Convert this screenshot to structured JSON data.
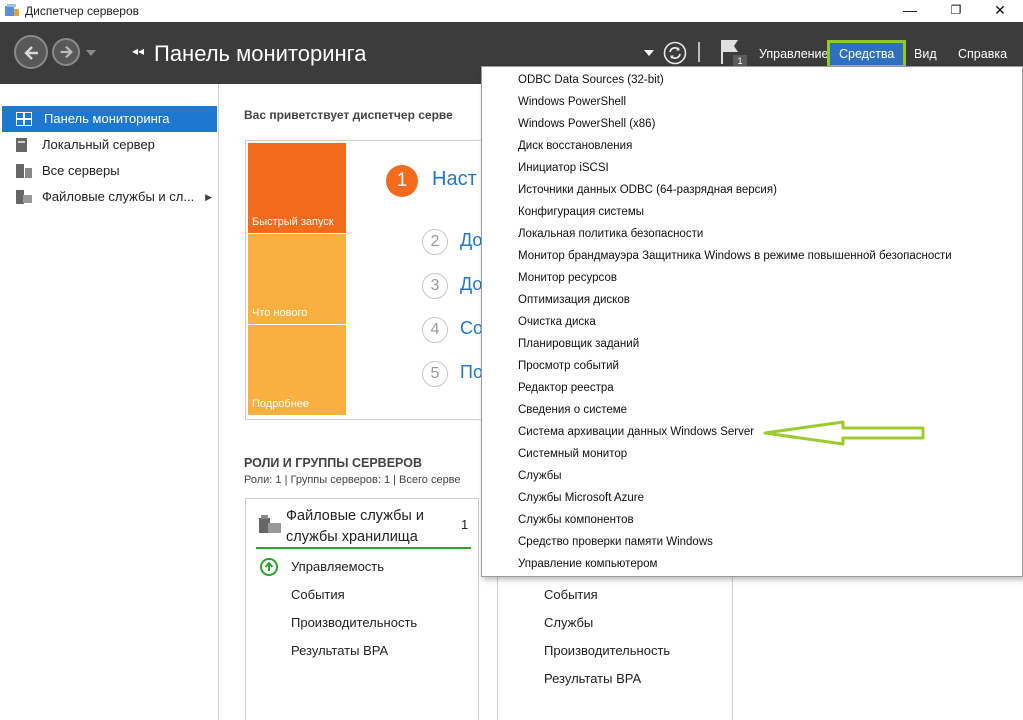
{
  "window": {
    "title": "Диспетчер серверов",
    "controls": {
      "minimize": "—",
      "restore": "❐",
      "close": "✕"
    }
  },
  "header": {
    "breadcrumb_arrows": "◂◂",
    "page_title": "Панель мониторинга",
    "flag_count": "1",
    "menu": {
      "manage": "Управление",
      "tools": "Средства",
      "view": "Вид",
      "help": "Справка"
    }
  },
  "sidebar": {
    "items": [
      {
        "label": "Панель мониторинга",
        "icon": "dashboard-icon"
      },
      {
        "label": "Локальный сервер",
        "icon": "server-icon"
      },
      {
        "label": "Все серверы",
        "icon": "servers-icon"
      },
      {
        "label": "Файловые службы и сл...",
        "icon": "file-services-icon"
      }
    ]
  },
  "main": {
    "welcome": "Вас приветствует диспетчер серве",
    "tiles": {
      "quick_start": "Быстрый запуск",
      "whats_new": "Что нового",
      "learn_more": "Подробнее"
    },
    "steps": [
      {
        "num": "1",
        "label": "Наст"
      },
      {
        "num": "2",
        "label": "До"
      },
      {
        "num": "3",
        "label": "До"
      },
      {
        "num": "4",
        "label": "Со"
      },
      {
        "num": "5",
        "label": "По"
      }
    ],
    "roles_title": "РОЛИ И ГРУППЫ СЕРВЕРОВ",
    "roles_sub": "Роли: 1 | Группы серверов: 1 | Всего серве",
    "card1": {
      "title": "Файловые службы и службы хранилища",
      "count": "1",
      "rows": [
        "Управляемость",
        "События",
        "Производительность",
        "Результаты BPA"
      ]
    },
    "card2": {
      "rows": [
        "События",
        "Службы",
        "Производительность",
        "Результаты BPA"
      ]
    }
  },
  "tools_menu": {
    "items": [
      "ODBC Data Sources (32-bit)",
      "Windows PowerShell",
      "Windows PowerShell (x86)",
      "Диск восстановления",
      "Инициатор iSCSI",
      "Источники данных ODBC (64-разрядная версия)",
      "Конфигурация системы",
      "Локальная политика безопасности",
      "Монитор брандмауэра Защитника Windows в режиме повышенной безопасности",
      "Монитор ресурсов",
      "Оптимизация дисков",
      "Очистка диска",
      "Планировщик заданий",
      "Просмотр событий",
      "Редактор реестра",
      "Сведения о системе",
      "Система архивации данных Windows Server",
      "Системный монитор",
      "Службы",
      "Службы Microsoft Azure",
      "Службы компонентов",
      "Средство проверки памяти Windows",
      "Управление компьютером"
    ]
  },
  "colors": {
    "header_bg": "#3c3c3c",
    "accent_blue": "#1e78d2",
    "tile_orange": "#f26a1b",
    "tile_yellow": "#fab041",
    "highlight_green": "#8ecb25"
  }
}
